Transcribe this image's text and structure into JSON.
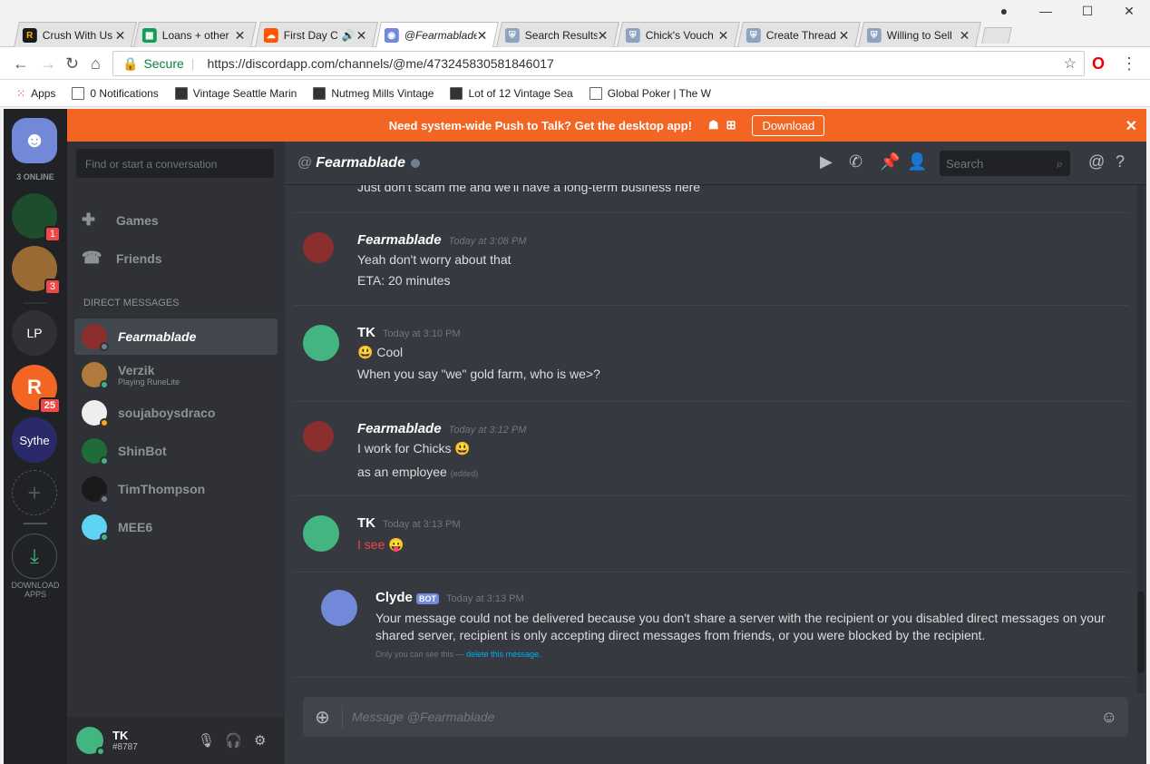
{
  "browser": {
    "tabs": [
      {
        "title": "Crush With Us",
        "color": "#ffb300"
      },
      {
        "title": "Loans + other",
        "color": "#0f9d58"
      },
      {
        "title": "First Day C",
        "color": "#ff5500"
      },
      {
        "title": "@Fearmablade",
        "color": "#7289da"
      },
      {
        "title": "Search Results",
        "color": "#8ea3bf"
      },
      {
        "title": "Chick's Vouch",
        "color": "#8ea3bf"
      },
      {
        "title": "Create Thread",
        "color": "#8ea3bf"
      },
      {
        "title": "Willing to Sell",
        "color": "#8ea3bf"
      }
    ],
    "secure_label": "Secure",
    "url": "https://discordapp.com/channels/@me/473245830581846017",
    "bookmarks": [
      "Apps",
      "0 Notifications",
      "Vintage Seattle Marin",
      "Nutmeg Mills Vintage",
      "Lot of 12 Vintage Sea",
      "Global Poker | The W"
    ]
  },
  "banner": {
    "text": "Need system-wide Push to Talk? Get the desktop app!",
    "button": "Download"
  },
  "guilds": {
    "online": "3 ONLINE",
    "badges": [
      "1",
      "3",
      "25"
    ],
    "lp": "LP",
    "sythe": "Sythe",
    "download": "DOWNLOAD APPS"
  },
  "sidebar": {
    "search_placeholder": "Find or start a conversation",
    "games": "Games",
    "friends": "Friends",
    "section": "DIRECT MESSAGES",
    "dms": [
      {
        "name": "Fearmablade",
        "sub": "",
        "color": "#8b2e2e",
        "status": "#747f8d"
      },
      {
        "name": "Verzik",
        "sub": "Playing RuneLite",
        "color": "#b07a3c",
        "status": "#43b581"
      },
      {
        "name": "soujaboysdraco",
        "sub": "",
        "color": "#eeeeee",
        "status": "#faa61a"
      },
      {
        "name": "ShinBot",
        "sub": "",
        "color": "#1f6b3a",
        "status": "#43b581"
      },
      {
        "name": "TimThompson",
        "sub": "",
        "color": "#1a1a1a",
        "status": "#747f8d"
      },
      {
        "name": "MEE6",
        "sub": "",
        "color": "#5fd3f3",
        "status": "#43b581"
      }
    ]
  },
  "user": {
    "name": "TK",
    "tag": "#8787"
  },
  "chat": {
    "recipient": "Fearmablade",
    "search": "Search",
    "top_line": "Just don't scam me and we'll have a long-term business here",
    "messages": [
      {
        "author": "Fearmablade",
        "time": "Today at 3:08 PM",
        "lines": [
          "Yeah don't worry about that",
          "ETA: 20 minutes"
        ]
      },
      {
        "author": "TK",
        "time": "Today at 3:10 PM",
        "lines": [
          "Cool",
          "When you say \"we\" gold farm, who is we>?"
        ]
      },
      {
        "author": "Fearmablade",
        "time": "Today at 3:12 PM",
        "lines": [
          "I work for Chicks",
          "as an employee"
        ],
        "edited": "(edited)"
      },
      {
        "author": "TK",
        "time": "Today at 3:13 PM",
        "lines": [
          "I see"
        ]
      },
      {
        "author": "Clyde",
        "badge": "BOT",
        "time": "Today at 3:13 PM",
        "lines": [
          "Your message could not be delivered because you don't share a server with the recipient or you disabled direct messages on your",
          "shared server, recipient is only accepting direct messages from friends, or you were blocked by the recipient."
        ],
        "note": "Only you can see this —",
        "note_link": "delete this message."
      }
    ],
    "composer_placeholder": "Message @Fearmablade"
  },
  "colors": {
    "blurple": "#7289da",
    "green": "#43b581",
    "red": "#f04747",
    "orange": "#f26522"
  }
}
